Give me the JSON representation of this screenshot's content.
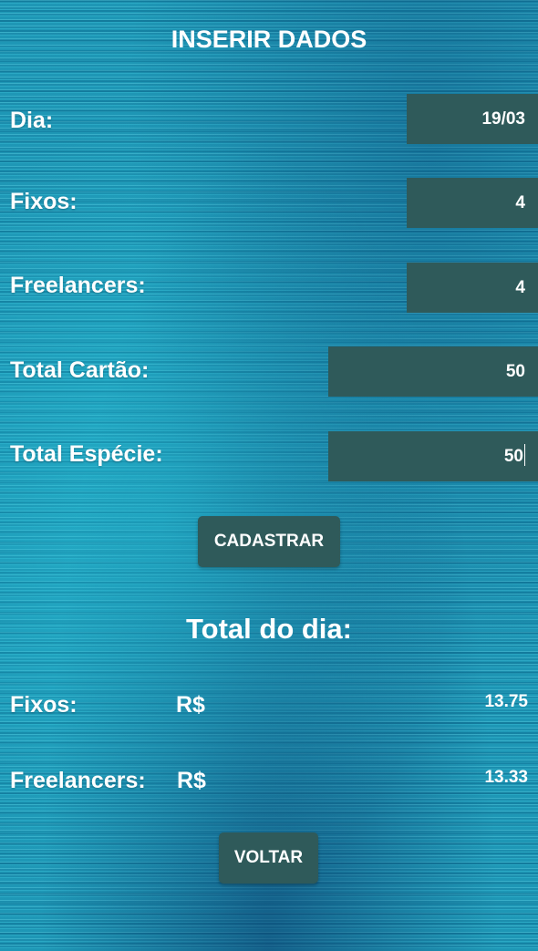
{
  "header": {
    "title": "INSERIR DADOS"
  },
  "form": {
    "dia": {
      "label": "Dia:",
      "value": "19/03"
    },
    "fixos": {
      "label": "Fixos:",
      "value": "4"
    },
    "freelancers": {
      "label": "Freelancers:",
      "value": "4"
    },
    "total_cartao": {
      "label": "Total Cartão:",
      "value": "50"
    },
    "total_especie": {
      "label": "Total Espécie:",
      "value": "50"
    },
    "submit_label": "CADASTRAR"
  },
  "totals": {
    "title": "Total do dia:",
    "currency_symbol": "R$",
    "fixos": {
      "label": "Fixos:",
      "currency": "R$",
      "amount": "13.75"
    },
    "freelancers": {
      "label": "Freelancers:",
      "currency": "R$",
      "amount": "13.33"
    }
  },
  "footer": {
    "back_label": "VOLTAR"
  },
  "colors": {
    "background": "#1a9fbe",
    "field_background": "#2f5a5a",
    "text": "#ffffff"
  }
}
